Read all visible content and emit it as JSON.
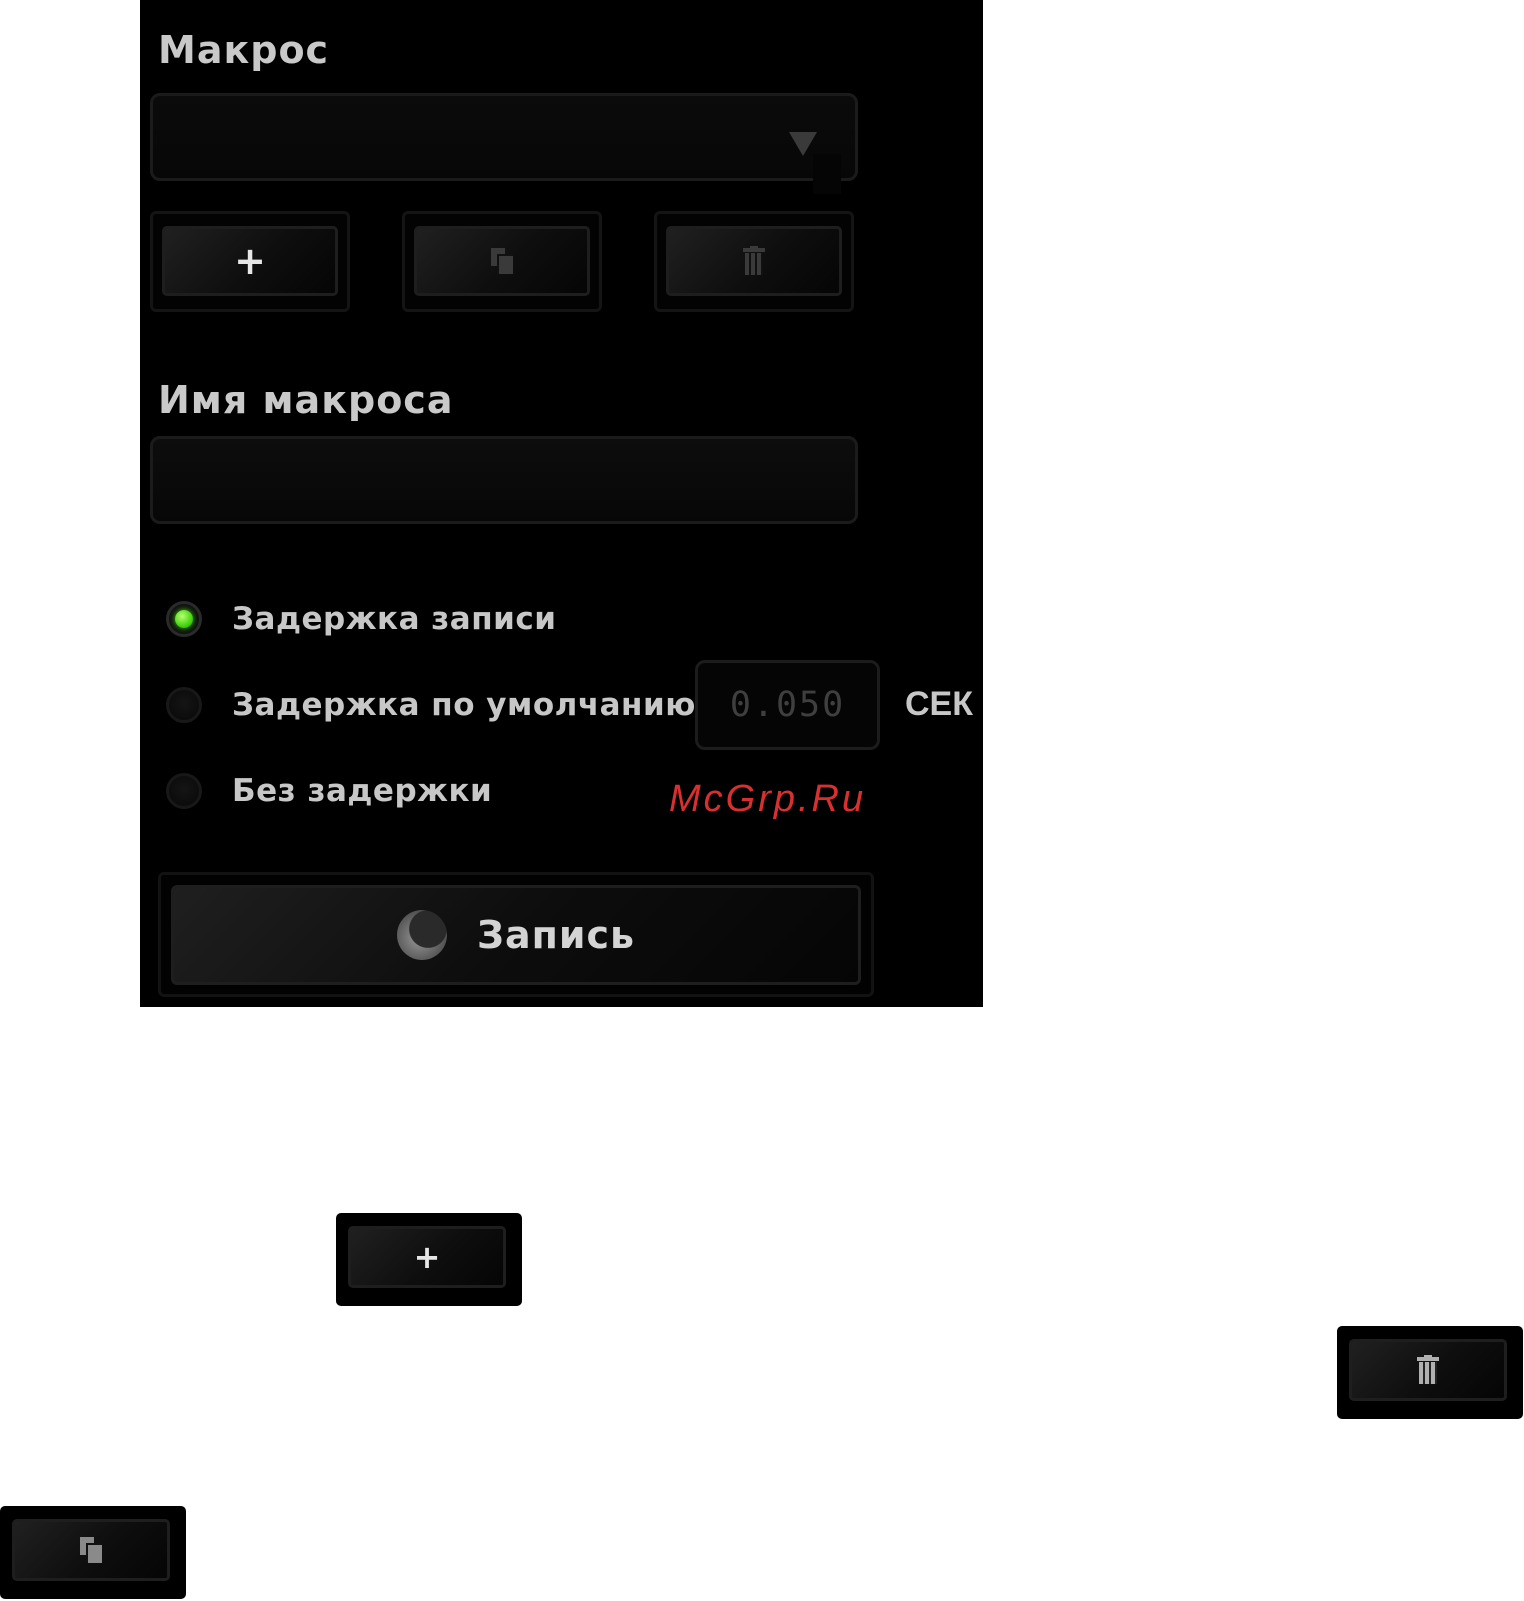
{
  "macro": {
    "section_label": "Макрос",
    "selected_value": ""
  },
  "actions": {
    "add_icon": "plus-icon",
    "copy_icon": "copy-icon",
    "delete_icon": "trash-icon"
  },
  "macro_name": {
    "label": "Имя макроса",
    "value": ""
  },
  "delay_options": [
    {
      "label": "Задержка записи",
      "selected": true
    },
    {
      "label": "Задержка по умолчанию",
      "selected": false
    },
    {
      "label": "Без задержки",
      "selected": false
    }
  ],
  "default_delay": {
    "value": "0.050",
    "unit": "СЕК"
  },
  "watermark": "McGrp.Ru",
  "record": {
    "label": "Запись"
  },
  "colors": {
    "panel_bg": "#000000",
    "accent_green": "#44d60e",
    "watermark_red": "#d8302f"
  }
}
